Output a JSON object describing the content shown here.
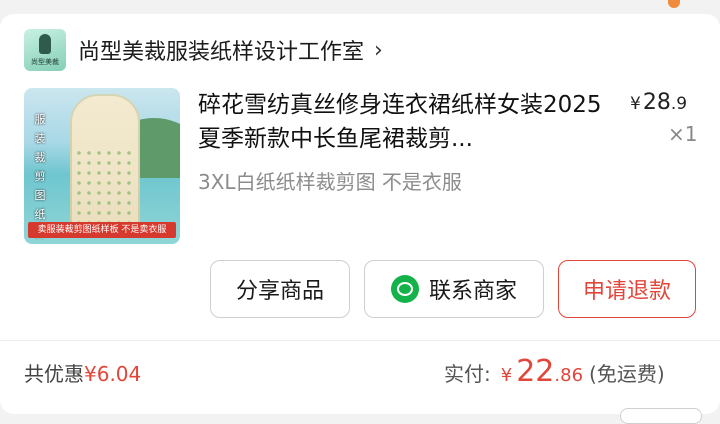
{
  "shop": {
    "name": "尚型美裁服装纸样设计工作室",
    "logo_text": "尚型美裁",
    "chevron": "›"
  },
  "product": {
    "title": "碎花雪纺真丝修身连衣裙纸样女装2025夏季新款中长鱼尾裙裁剪...",
    "price_symbol": "¥",
    "price_int": "28",
    "price_dec": ".9",
    "quantity": "×1",
    "spec": "3XL白纸纸样裁剪图 不是衣服",
    "thumbnail_vertical_text": "服装裁剪图纸样",
    "thumbnail_banner": "卖服装裁剪图纸样板 不是卖衣服"
  },
  "actions": {
    "share_label": "分享商品",
    "contact_label": "联系商家",
    "refund_label": "申请退款"
  },
  "summary": {
    "discount_label": "共优惠",
    "discount_amount": "¥6.04",
    "paid_label": "实付:",
    "paid_symbol": "¥",
    "paid_int": "22",
    "paid_dec": ".86",
    "shipping_note": "(免运费)"
  },
  "colors": {
    "accent_red": "#e2463a",
    "wechat_green": "#13b24a"
  },
  "icons": {
    "contact": "wechat-icon",
    "shop_arrow": "chevron-right-icon"
  }
}
